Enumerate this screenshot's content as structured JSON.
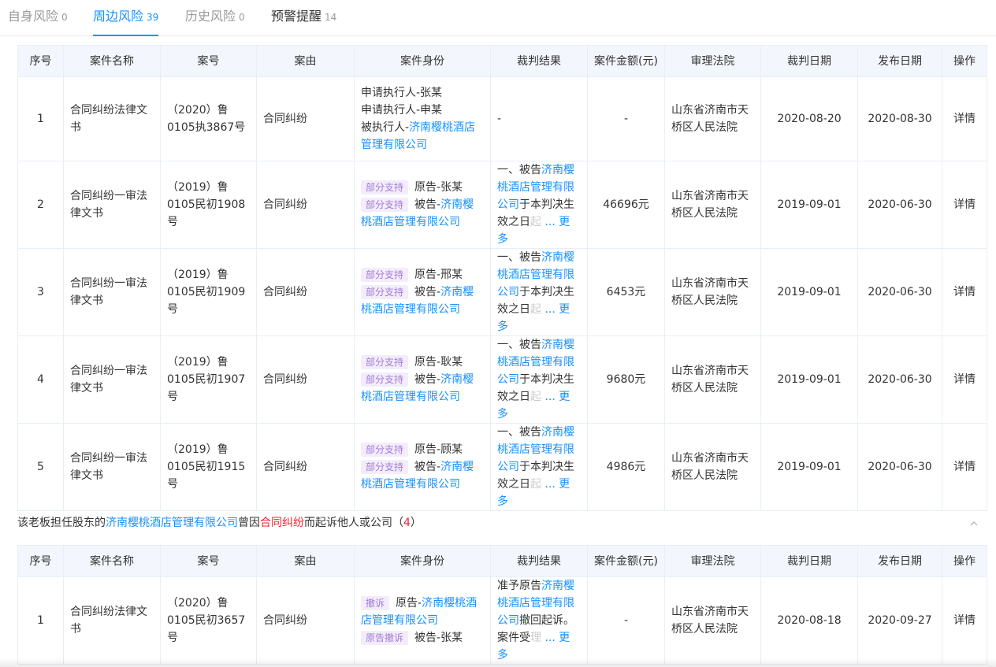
{
  "tabs": [
    {
      "label": "自身风险",
      "count": "0"
    },
    {
      "label": "周边风险",
      "count": "39"
    },
    {
      "label": "历史风险",
      "count": "0"
    },
    {
      "label": "预警提醒",
      "count": "14"
    }
  ],
  "columns": [
    "序号",
    "案件名称",
    "案号",
    "案由",
    "案件身份",
    "裁判结果",
    "案件金额(元)",
    "审理法院",
    "裁判日期",
    "发布日期",
    "操作"
  ],
  "table1": {
    "rows": [
      {
        "no": "1",
        "name": "合同纠纷法律文书",
        "case_no": "（2020）鲁0105执3867号",
        "cause": "合同纠纷",
        "identity": {
          "l1": "申请执行人-张某",
          "l2": "申请执行人-申某",
          "l3_pre": "被执行人-",
          "l3_link": "济南樱桃酒店管理有限公司"
        },
        "result": "-",
        "amount": "-",
        "court": "山东省济南市天桥区人民法院",
        "judge_date": "2020-08-20",
        "pub_date": "2020-08-30",
        "op": "详情"
      },
      {
        "no": "2",
        "name": "合同纠纷一审法律文书",
        "case_no": "（2019）鲁0105民初1908号",
        "cause": "合同纠纷",
        "identity": {
          "tag1": "部分支持",
          "p1": "原告-张某",
          "tag2": "部分支持",
          "p2_pre": "被告-",
          "p2_link": "济南樱桃酒店管理有限公司"
        },
        "result": {
          "pre": "一、被告",
          "link": "济南樱桃酒店管理有限公司",
          "post": "于本判决生效之日",
          "fade": "起",
          "more": "... 更多"
        },
        "amount": "46696元",
        "court": "山东省济南市天桥区人民法院",
        "judge_date": "2019-09-01",
        "pub_date": "2020-06-30",
        "op": "详情"
      },
      {
        "no": "3",
        "name": "合同纠纷一审法律文书",
        "case_no": "（2019）鲁0105民初1909号",
        "cause": "合同纠纷",
        "identity": {
          "tag1": "部分支持",
          "p1": "原告-邢某",
          "tag2": "部分支持",
          "p2_pre": "被告-",
          "p2_link": "济南樱桃酒店管理有限公司"
        },
        "result": {
          "pre": "一、被告",
          "link": "济南樱桃酒店管理有限公司",
          "post": "于本判决生效之日",
          "fade": "起",
          "more": "... 更多"
        },
        "amount": "6453元",
        "court": "山东省济南市天桥区人民法院",
        "judge_date": "2019-09-01",
        "pub_date": "2020-06-30",
        "op": "详情"
      },
      {
        "no": "4",
        "name": "合同纠纷一审法律文书",
        "case_no": "（2019）鲁0105民初1907号",
        "cause": "合同纠纷",
        "identity": {
          "tag1": "部分支持",
          "p1": "原告-耿某",
          "tag2": "部分支持",
          "p2_pre": "被告-",
          "p2_link": "济南樱桃酒店管理有限公司"
        },
        "result": {
          "pre": "一、被告",
          "link": "济南樱桃酒店管理有限公司",
          "post": "于本判决生效之日",
          "fade": "起",
          "more": "... 更多"
        },
        "amount": "9680元",
        "court": "山东省济南市天桥区人民法院",
        "judge_date": "2019-09-01",
        "pub_date": "2020-06-30",
        "op": "详情"
      },
      {
        "no": "5",
        "name": "合同纠纷一审法律文书",
        "case_no": "（2019）鲁0105民初1915号",
        "cause": "合同纠纷",
        "identity": {
          "tag1": "部分支持",
          "p1": "原告-顾某",
          "tag2": "部分支持",
          "p2_pre": "被告-",
          "p2_link": "济南樱桃酒店管理有限公司"
        },
        "result": {
          "pre": "一、被告",
          "link": "济南樱桃酒店管理有限公司",
          "post": "于本判决生效之日",
          "fade": "起",
          "more": "... 更多"
        },
        "amount": "4986元",
        "court": "山东省济南市天桥区人民法院",
        "judge_date": "2019-09-01",
        "pub_date": "2020-06-30",
        "op": "详情"
      }
    ]
  },
  "section2": {
    "pre": "该老板担任股东的",
    "company": "济南樱桃酒店管理有限公司",
    "mid": "曾因",
    "cause": "合同纠纷",
    "post": "而起诉他人或公司（",
    "count": "4",
    "close": "）",
    "collapse_icon": "chevron-up-icon"
  },
  "table2": {
    "rows": [
      {
        "no": "1",
        "name": "合同纠纷法律文书",
        "case_no": "（2020）鲁0105民初3657号",
        "cause": "合同纠纷",
        "identity": {
          "tag1": "撤诉",
          "p1_pre": "原告-",
          "p1_link": "济南樱桃酒店管理有限公司",
          "tag2": "原告撤诉",
          "p2": "被告-张某"
        },
        "result": {
          "pre": "准予原告",
          "link": "济南樱桃酒店管理有限公司",
          "post": "撤回起诉。案件受",
          "fade": "理",
          "more": "... 更多"
        },
        "amount": "-",
        "court": "山东省济南市天桥区人民法院",
        "judge_date": "2020-08-18",
        "pub_date": "2020-09-27",
        "op": "详情"
      }
    ]
  }
}
